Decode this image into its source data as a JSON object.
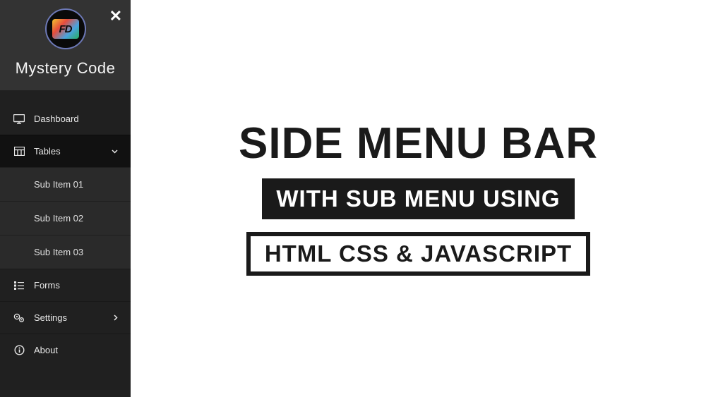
{
  "brand": {
    "title": "Mystery Code",
    "logo_text": "FD"
  },
  "sidebar": {
    "items": [
      {
        "label": "Dashboard"
      },
      {
        "label": "Tables"
      },
      {
        "label": "Forms"
      },
      {
        "label": "Settings"
      },
      {
        "label": "About"
      }
    ],
    "submenu": [
      {
        "label": "Sub Item 01"
      },
      {
        "label": "Sub Item 02"
      },
      {
        "label": "Sub Item 03"
      }
    ]
  },
  "main": {
    "title": "SIDE MENU BAR",
    "subtitle1": "WITH SUB MENU USING",
    "subtitle2": "HTML CSS & JAVASCRIPT"
  }
}
